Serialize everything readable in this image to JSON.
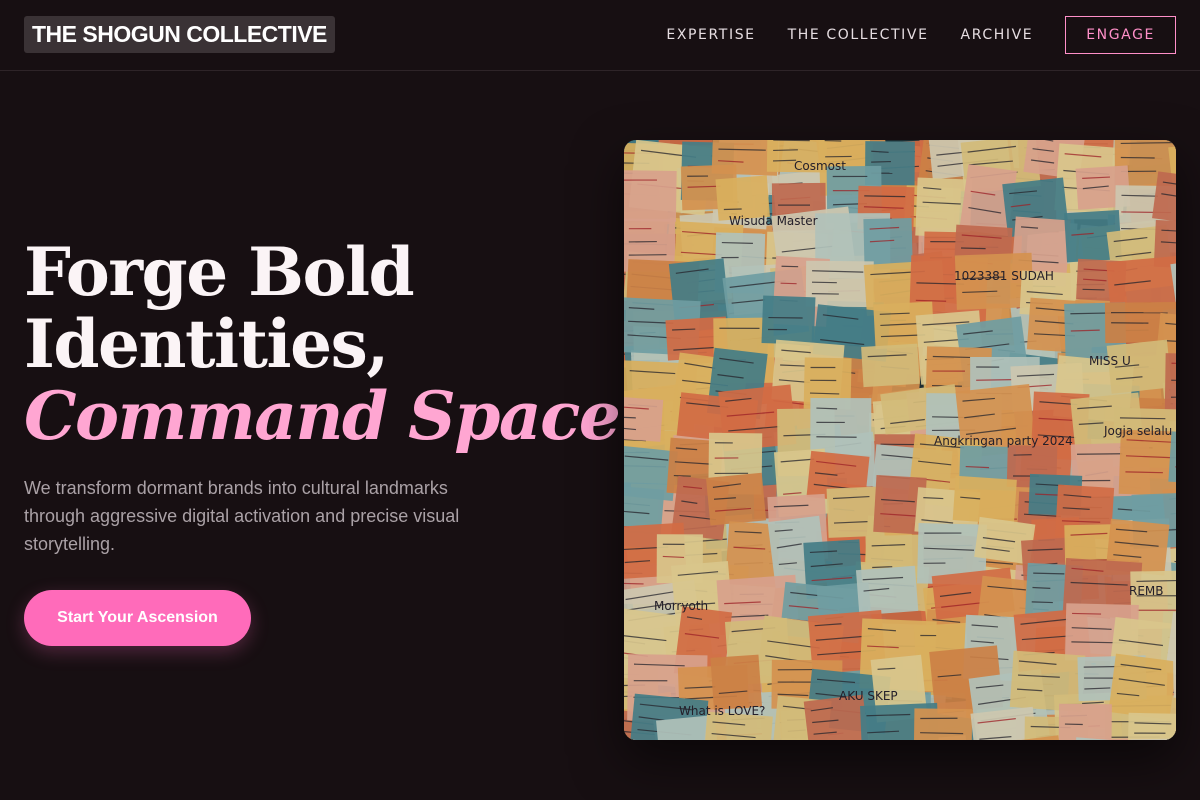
{
  "header": {
    "logo": "THE SHOGUN COLLECTIVE",
    "nav": [
      "EXPERTISE",
      "THE COLLECTIVE",
      "ARCHIVE"
    ],
    "cta": "ENGAGE"
  },
  "hero": {
    "title_line1": "Forge Bold",
    "title_line2": "Identities,",
    "title_line3": "Command Space.",
    "subtitle": "We transform dormant brands into cultural landmarks through aggressive digital activation and precise visual storytelling.",
    "button": "Start Your Ascension"
  },
  "image": {
    "subject": "wall covered in colorful handwritten sticky notes",
    "notes": [
      "Cosmost",
      "Wisuda Master",
      "MISS U",
      "Jogja selalu istimewa",
      "AKU SKEP",
      "REMB",
      "What is LOVE?",
      "1023381 SUDAH",
      "Angkringan party 2024",
      "Morryoth"
    ]
  },
  "colors": {
    "background": "#170f12",
    "accent_pink": "#ff6bba",
    "title_accent": "#ffa6d2",
    "engage_border": "#ff8fc8"
  }
}
